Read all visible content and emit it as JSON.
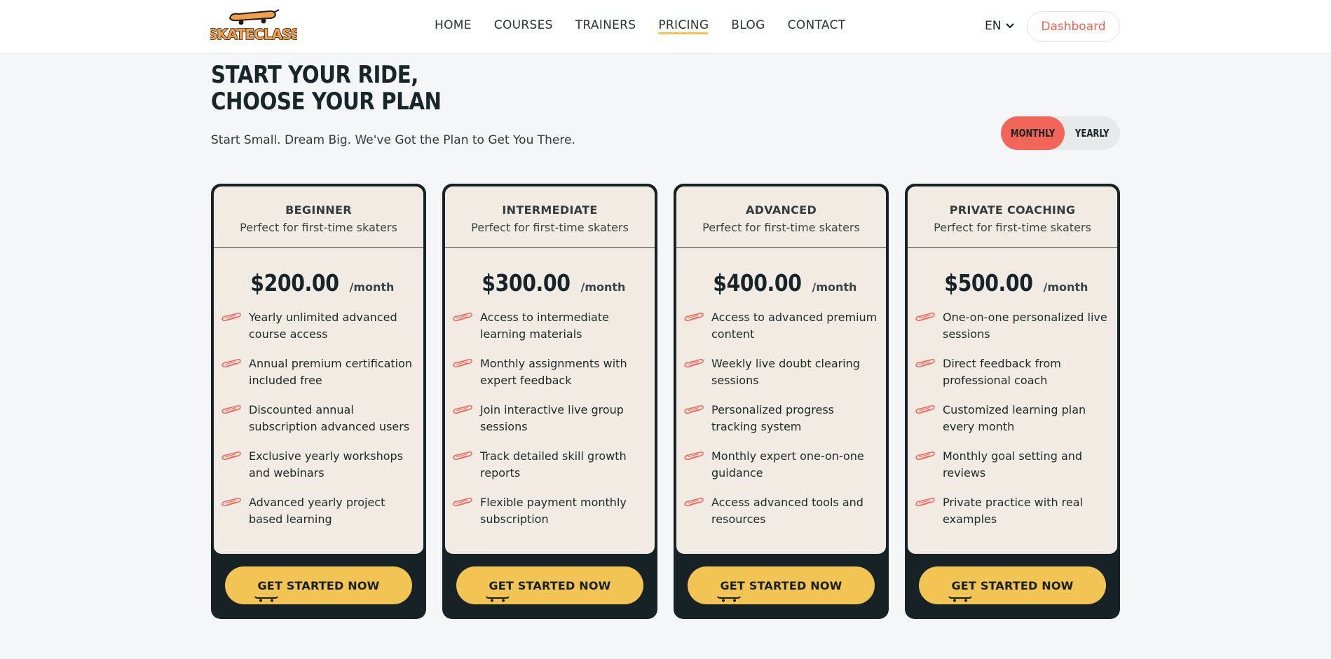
{
  "header": {
    "logo_text": "SKATECLASS",
    "nav": [
      "HOME",
      "COURSES",
      "TRAINERS",
      "PRICING",
      "BLOG",
      "CONTACT"
    ],
    "active_nav": "PRICING",
    "language": "EN",
    "dashboard_label": "Dashboard"
  },
  "hero": {
    "title": "START YOUR RIDE, CHOOSE YOUR PLAN",
    "subtitle": "Start Small. Dream Big. We've Got the Plan to Get You There."
  },
  "billing_toggle": {
    "monthly": "MONTHLY",
    "yearly": "YEARLY",
    "selected": "MONTHLY"
  },
  "colors": {
    "accent_red": "#f2665a",
    "accent_yellow": "#f1c453",
    "dark": "#172226",
    "card_bg": "#f1ebe3"
  },
  "plans": [
    {
      "name": "BEGINNER",
      "desc": "Perfect for first-time skaters",
      "price": "$200.00",
      "period": "/month",
      "features": [
        "Yearly unlimited advanced course access",
        "Annual premium certification included free",
        "Discounted annual subscription advanced users",
        "Exclusive yearly workshops and webinars",
        "Advanced yearly project based learning"
      ],
      "cta": "GET STARTED NOW"
    },
    {
      "name": "INTERMEDIATE",
      "desc": "Perfect for first-time skaters",
      "price": "$300.00",
      "period": "/month",
      "features": [
        "Access to intermediate learning materials",
        "Monthly assignments with expert feedback",
        "Join interactive live group sessions",
        "Track detailed skill growth reports",
        "Flexible payment monthly subscription"
      ],
      "cta": "GET STARTED NOW"
    },
    {
      "name": "ADVANCED",
      "desc": "Perfect for first-time skaters",
      "price": "$400.00",
      "period": "/month",
      "features": [
        "Access to advanced premium content",
        "Weekly live doubt clearing sessions",
        "Personalized progress tracking system",
        "Monthly expert one-on-one guidance",
        "Access advanced tools and resources"
      ],
      "cta": "GET STARTED NOW"
    },
    {
      "name": "PRIVATE COACHING",
      "desc": "Perfect for first-time skaters",
      "price": "$500.00",
      "period": "/month",
      "features": [
        "One-on-one personalized live sessions",
        "Direct feedback from professional coach",
        "Customized learning plan every month",
        "Monthly goal setting and reviews",
        "Private practice with real examples"
      ],
      "cta": "GET STARTED NOW"
    }
  ]
}
